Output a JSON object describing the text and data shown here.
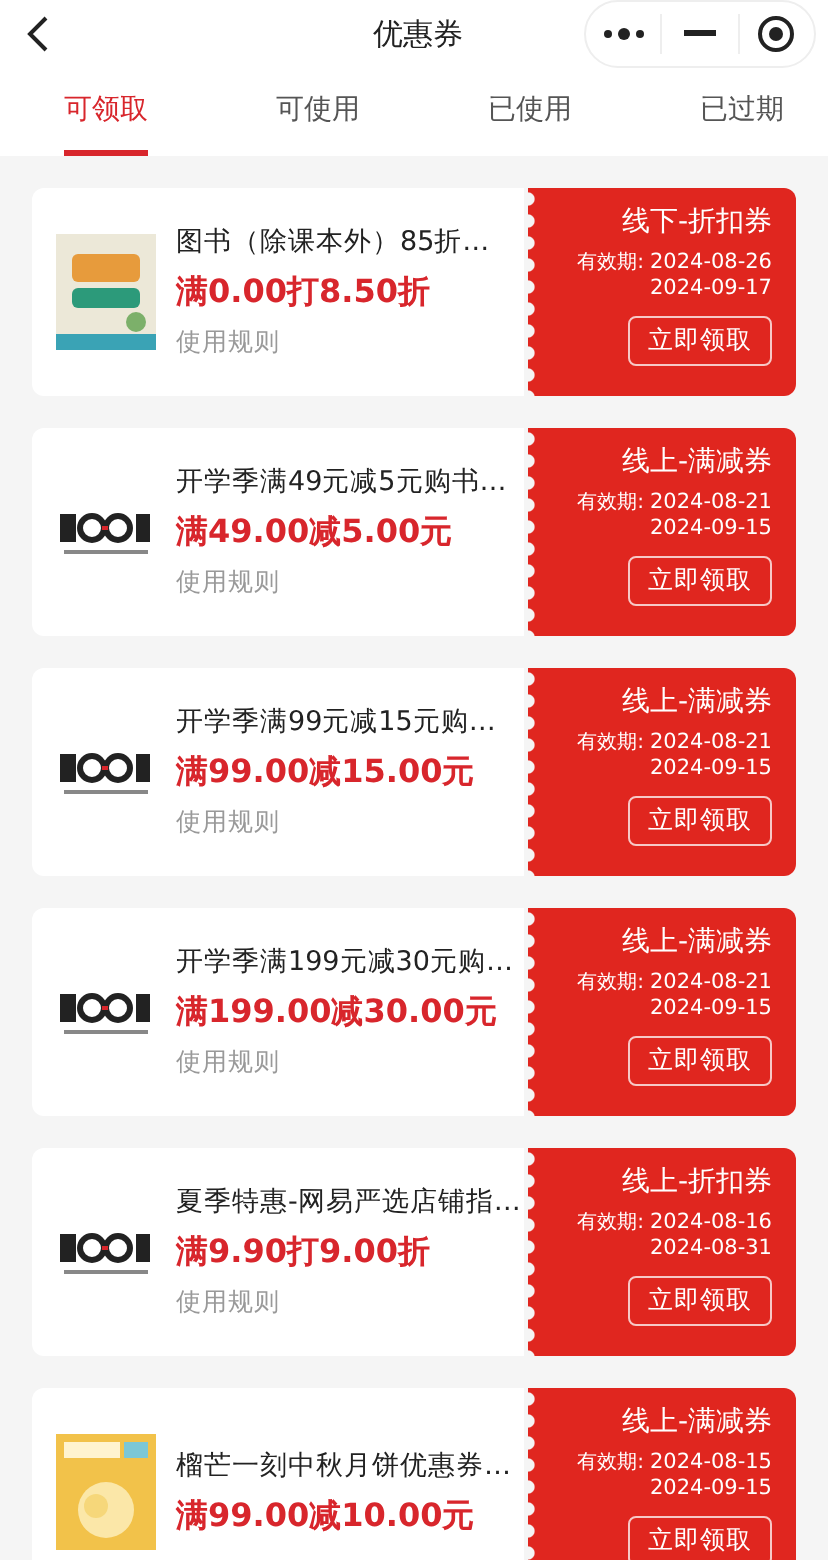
{
  "header": {
    "title": "优惠券"
  },
  "tabs": [
    {
      "label": "可领取",
      "selected": true
    },
    {
      "label": "可使用",
      "selected": false
    },
    {
      "label": "已使用",
      "selected": false
    },
    {
      "label": "已过期",
      "selected": false
    }
  ],
  "coupons": [
    {
      "title": "图书（除课本外）85折…",
      "amount": "满0.00打8.50折",
      "rule": "使用规则",
      "type": "线下-折扣券",
      "validity_label": "有效期:",
      "start": "2024-08-26",
      "end": "2024-09-17",
      "action": "立即领取"
    },
    {
      "title": "开学季满49元减5元购书…",
      "amount": "满49.00减5.00元",
      "rule": "使用规则",
      "type": "线上-满减券",
      "validity_label": "有效期:",
      "start": "2024-08-21",
      "end": "2024-09-15",
      "action": "立即领取"
    },
    {
      "title": "开学季满99元减15元购…",
      "amount": "满99.00减15.00元",
      "rule": "使用规则",
      "type": "线上-满减券",
      "validity_label": "有效期:",
      "start": "2024-08-21",
      "end": "2024-09-15",
      "action": "立即领取"
    },
    {
      "title": "开学季满199元减30元购…",
      "amount": "满199.00减30.00元",
      "rule": "使用规则",
      "type": "线上-满减券",
      "validity_label": "有效期:",
      "start": "2024-08-21",
      "end": "2024-09-15",
      "action": "立即领取"
    },
    {
      "title": "夏季特惠-网易严选店铺指…",
      "amount": "满9.90打9.00折",
      "rule": "使用规则",
      "type": "线上-折扣券",
      "validity_label": "有效期:",
      "start": "2024-08-16",
      "end": "2024-08-31",
      "action": "立即领取"
    },
    {
      "title": "榴芒一刻中秋月饼优惠券…",
      "amount": "满99.00减10.00元",
      "type": "线上-满减券",
      "validity_label": "有效期:",
      "start": "2024-08-15",
      "end": "2024-09-15",
      "action": "立即领取"
    }
  ]
}
